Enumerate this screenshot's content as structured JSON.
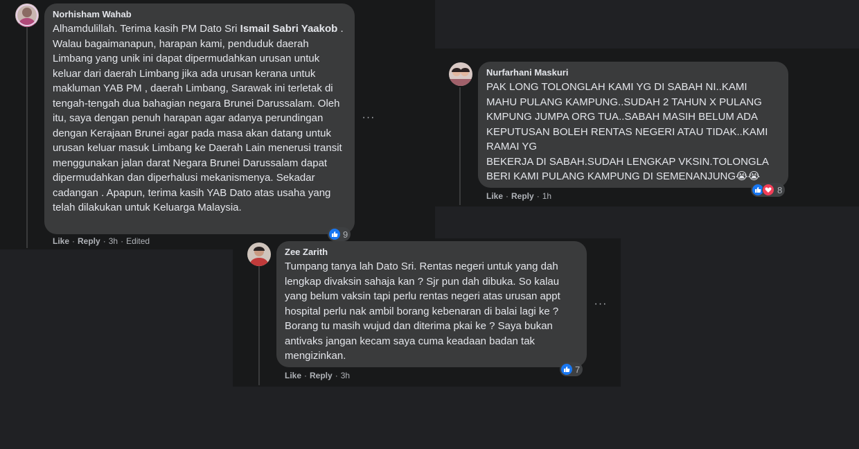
{
  "comments": [
    {
      "author": "Norhisham Wahab",
      "text_pre": "Alhamdulillah. Terima kasih PM Dato Sri ",
      "mention": "Ismail Sabri Yaakob",
      "text_post": " . Walau bagaimanapun, harapan kami, penduduk daerah Limbang yang unik ini dapat dipermudahkan urusan untuk keluar dari daerah Limbang jika ada urusan kerana untuk makluman YAB PM , daerah Limbang, Sarawak ini terletak di tengah-tengah dua bahagian negara Brunei Darussalam. Oleh itu, saya dengan penuh harapan agar adanya perundingan dengan Kerajaan Brunei agar pada masa akan datang untuk urusan keluar masuk Limbang ke Daerah Lain menerusi transit menggunakan jalan darat Negara Brunei Darussalam dapat dipermudahkan dan diperhalusi mekanismenya. Sekadar cadangan . Apapun, terima kasih YAB Dato atas usaha yang telah dilakukan untuk Keluarga Malaysia.",
      "reaction_count": "9",
      "like_label": "Like",
      "reply_label": "Reply",
      "time": "3h",
      "edited": "Edited",
      "more": "···"
    },
    {
      "author": "Nurfarhani Maskuri",
      "text": "PAK LONG TOLONGLAH KAMI YG DI SABAH NI..KAMI MAHU PULANG KAMPUNG..SUDAH 2 TAHUN X PULANG KMPUNG JUMPA ORG TUA..SABAH MASIH BELUM ADA KEPUTUSAN BOLEH RENTAS NEGERI ATAU TIDAK..KAMI RAMAI YG\nBEKERJA DI SABAH.SUDAH LENGKAP VKSIN.TOLONGLA BERI KAMI PULANG KAMPUNG DI SEMENANJUNG😭😭",
      "reaction_count": "8",
      "like_label": "Like",
      "reply_label": "Reply",
      "time": "1h"
    },
    {
      "author": "Zee Zarith",
      "text": "Tumpang tanya lah Dato Sri. Rentas negeri untuk yang dah lengkap divaksin sahaja kan ? Sjr pun dah dibuka. So kalau yang belum vaksin tapi perlu rentas negeri atas urusan appt hospital perlu nak ambil borang kebenaran di balai lagi ke ? Borang tu masih wujud dan diterima pkai ke ? Saya bukan antivaks jangan kecam saya cuma keadaan badan tak mengizinkan.",
      "reaction_count": "7",
      "like_label": "Like",
      "reply_label": "Reply",
      "time": "3h",
      "more": "···"
    }
  ],
  "icons": {
    "like": "thumbs-up-icon",
    "love": "heart-icon",
    "more": "more-options-icon"
  },
  "colors": {
    "like": "#1877f2",
    "love": "#f33e58",
    "bubble": "#3a3b3c",
    "panel": "#18191a"
  }
}
